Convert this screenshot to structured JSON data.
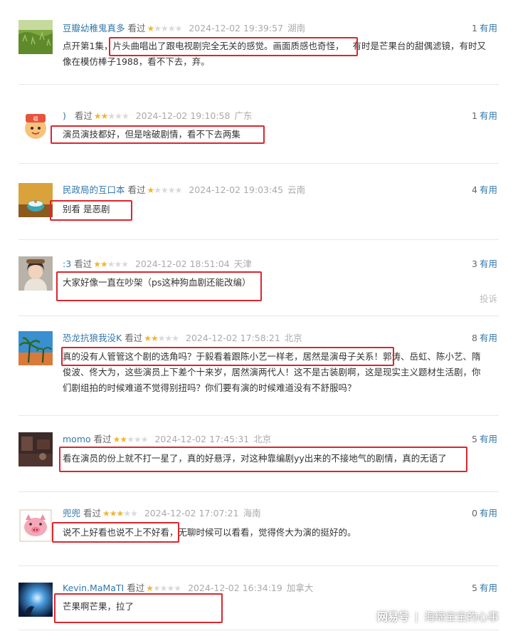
{
  "reviews": [
    {
      "user": "豆瓣幼稚鬼真多",
      "status": "看过",
      "stars": 1,
      "time": "2024-12-02 19:39:57",
      "location": "湖南",
      "useful_count": "1",
      "useful_label": "有用",
      "line1_pre": "点开第1集，",
      "line1_hl": "片头曲唱出了跟电视剧完全无关的感觉。画面质感也奇怪，",
      "line1_post": "有时是芒果台的甜偶滤镜，有时又",
      "line2": "像在模仿棒子1988，看不下去，弃。",
      "avatar": "green-field-avatar"
    },
    {
      "user": ")",
      "status": "看过",
      "stars": 2,
      "time": "2024-12-02 19:10:58",
      "location": "广东",
      "useful_count": "1",
      "useful_label": "有用",
      "text": "演员演技都好，但是啥破剧情，看不下去两集",
      "avatar": "cartoon-avatar"
    },
    {
      "user": "民政局的互口本",
      "status": "看过",
      "stars": 1,
      "time": "2024-12-02 19:03:45",
      "location": "云南",
      "useful_count": "4",
      "useful_label": "有用",
      "text": "别看 是恶剧",
      "avatar": "bowl-avatar"
    },
    {
      "user": ":3",
      "status": "看过",
      "stars": 2,
      "time": "2024-12-02 18:51:04",
      "location": "天津",
      "useful_count": "3",
      "useful_label": "有用",
      "text": "大家好像一直在吵架（ps这种狗血剧还能改编）",
      "report": "投诉",
      "avatar": "girl-avatar"
    },
    {
      "user": "恐龙抗狼我没K",
      "status": "看过",
      "stars": 2,
      "time": "2024-12-02 17:58:21",
      "location": "北京",
      "useful_count": "8",
      "useful_label": "有用",
      "line1_hl": "真的没有人管管这个剧的选角吗？于毅看着跟陈小艺一样老，居然是演母子关系！",
      "line1_post": "郭涛、岳虹、陈小艺、隋",
      "line2": "俊波、佟大为，这些演员上下差个十来岁，居然演两代人！这不是古装剧啊，这是现实主义题材生活剧，你",
      "line3": "们剧组拍的时候难道不觉得别扭吗？你们要有演的时候难道没有不舒服吗？",
      "avatar": "palm-avatar"
    },
    {
      "user": "momo",
      "status": "看过",
      "stars": 2,
      "time": "2024-12-02 17:45:31",
      "location": "北京",
      "useful_count": "5",
      "useful_label": "有用",
      "text": "看在演员的份上就不打一星了，真的好悬浮，对这种靠编剧yy出来的不接地气的剧情，真的无语了",
      "avatar": "dark-room-avatar"
    },
    {
      "user": "兜兜",
      "status": "看过",
      "stars": 3,
      "time": "2024-12-02 17:07:21",
      "location": "海南",
      "useful_count": "0",
      "useful_label": "有用",
      "text_hl": "说不上好看也说不上不好看，",
      "text_post": "无聊时候可以看看，觉得佟大为演的挺好的。",
      "avatar": "pig-avatar"
    },
    {
      "user": "Kevin.MaMaTI",
      "status": "看过",
      "stars": 1,
      "time": "2024-12-02 16:34:19",
      "location": "加拿大",
      "useful_count": "5",
      "useful_label": "有用",
      "text": "芒果啊芒果，拉了",
      "avatar": "blue-light-avatar"
    }
  ],
  "watermark": {
    "logo": "网易号",
    "separator": "|",
    "author": "海绵宝宝的心事"
  },
  "colors": {
    "link": "#3377aa",
    "star_on": "#f4b42f",
    "star_off": "#d9d9d9",
    "highlight": "#d9272e"
  }
}
